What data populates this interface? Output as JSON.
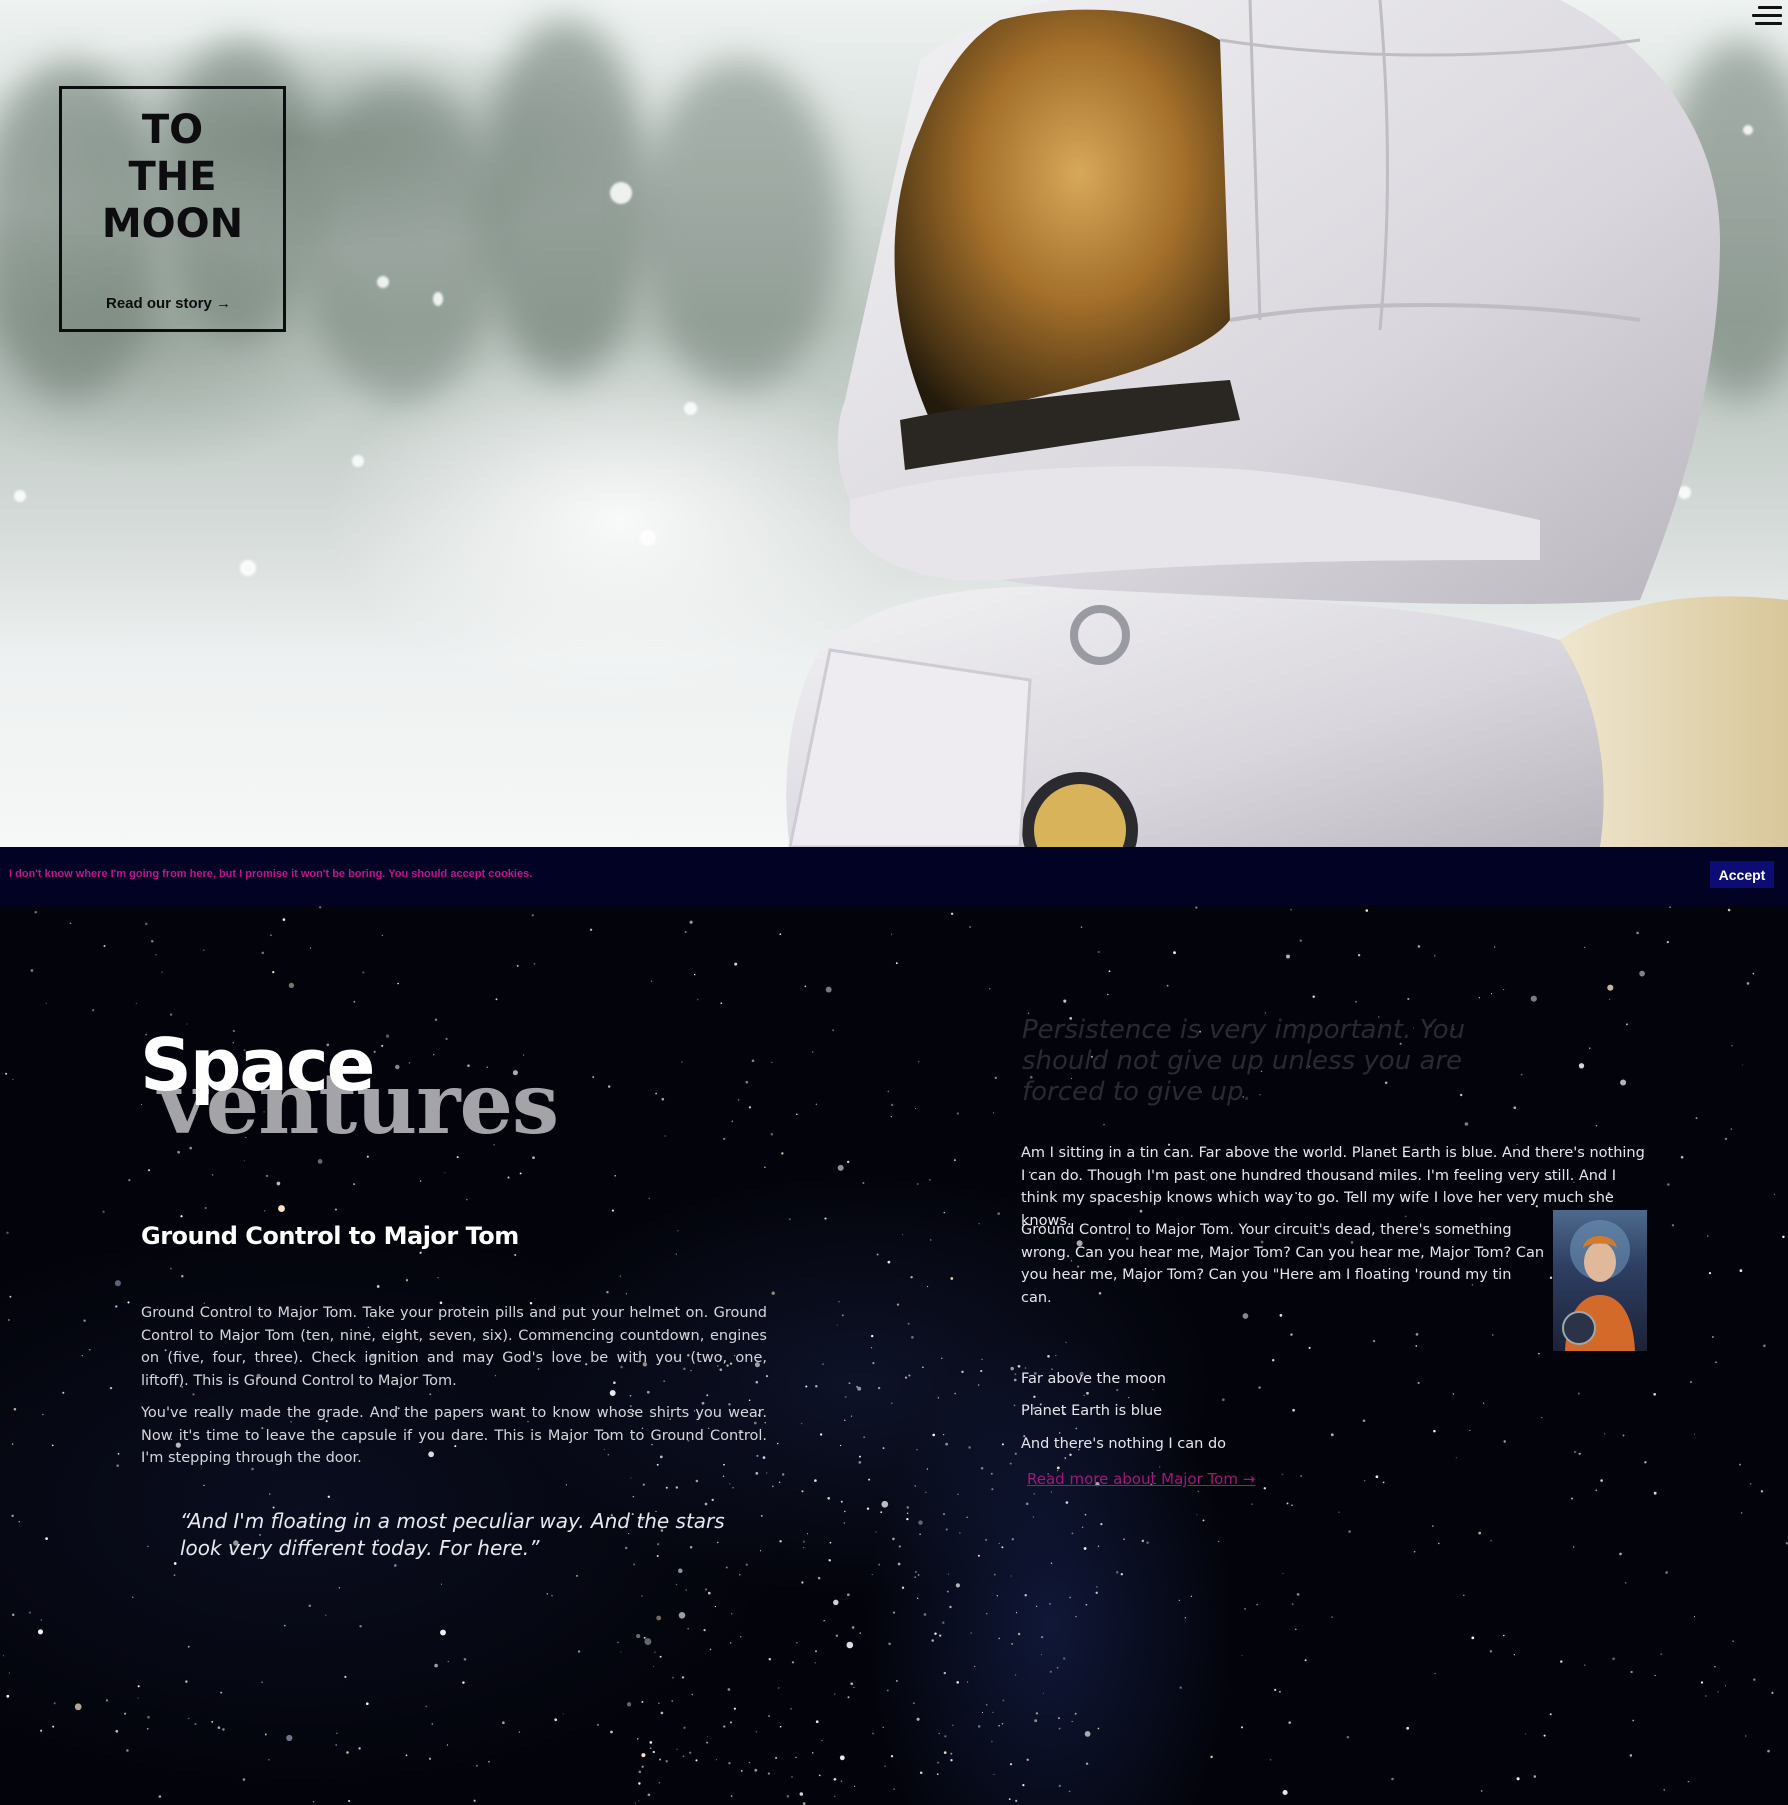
{
  "hero": {
    "logo_title": "TO\nTHE\nMOON",
    "logo_link": "Read our story →",
    "menu_icon": "hamburger-menu-icon"
  },
  "cookie": {
    "text": "I don't know where I'm going from here, but I promise it won't be boring. You should accept cookies.",
    "accept_label": "Accept"
  },
  "content": {
    "title_word1": "Space",
    "title_word2": "ventures",
    "subheading": "Ground Control to Major Tom",
    "paragraph1": "Ground Control to Major Tom. Take your protein pills and put your helmet on. Ground Control to Major Tom (ten, nine, eight, seven, six). Commencing countdown, engines on (five, four, three). Check ignition and may God's love be with you (two, one, liftoff). This is Ground Control to Major Tom.",
    "paragraph2": "You've really made the grade. And the papers want to know whose shirts you wear. Now it's time to leave the capsule if you dare. This is Major Tom to Ground Control. I'm stepping through the door.",
    "quote_left": "“And I'm floating in a most peculiar way. And the stars look very different today. For here.”",
    "quote_right": "Persistence is very important. You should not give up unless you are forced to give up.",
    "right_paragraph1": "Am I sitting in a tin can. Far above the world. Planet Earth is blue. And there's nothing I can do. Though I'm past one hundred thousand miles. I'm feeling very still. And I think my spaceship knows which way to go. Tell my wife I love her very much she knows.",
    "right_paragraph2": "Ground Control to Major Tom. Your circuit's dead, there's something wrong. Can you hear me, Major Tom? Can you hear me, Major Tom? Can you hear me, Major Tom? Can you \"Here am I floating 'round my tin can.",
    "list": [
      "Far above the moon",
      "Planet Earth is blue",
      "And there's nothing I can do"
    ],
    "read_more": "Read more about Major Tom →"
  },
  "colors": {
    "cookie_bg": "#020224",
    "cookie_text": "#c2148f",
    "accept_bg": "#0c0c74",
    "link": "#a3177a"
  }
}
